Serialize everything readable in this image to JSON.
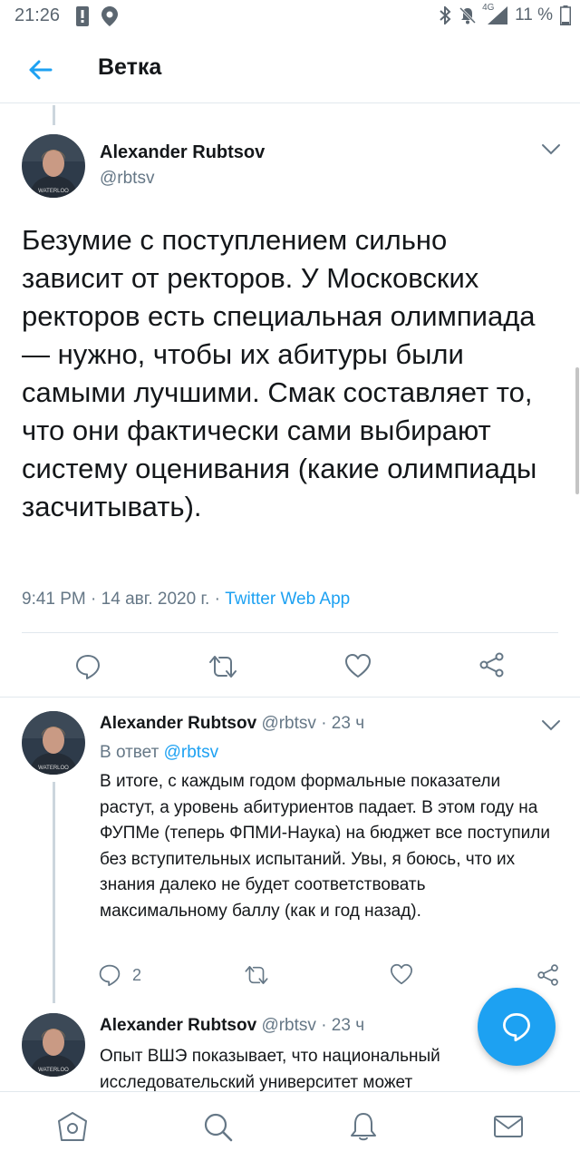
{
  "status_bar": {
    "time": "21:26",
    "battery": "11 %",
    "network": "4G",
    "icons": [
      "alert-icon",
      "location-icon",
      "bluetooth-icon",
      "mute-icon",
      "signal-icon",
      "battery-icon"
    ]
  },
  "header": {
    "title": "Ветка",
    "back_icon": "arrow-left-icon"
  },
  "main_tweet": {
    "name": "Alexander Rubtsov",
    "handle": "@rbtsv",
    "text": "Безумие с поступлением сильно зависит от ректоров. У Московских ректоров есть специальная олимпиада — нужно, чтобы их абитуры были самыми лучшими. Смак составляет то, что они фактически сами выбирают систему оценивания (какие олимпиады засчитывать).",
    "time": "9:41 PM",
    "date": "14 авг. 2020 г.",
    "sep": "·",
    "source": "Twitter Web App"
  },
  "replies": [
    {
      "name": "Alexander Rubtsov",
      "handle": "@rbtsv",
      "time_ago": "23 ч",
      "sep": "·",
      "reply_prefix": "В ответ",
      "reply_to": "@rbtsv",
      "text": "В итоге, с каждым годом формальные показатели растут, а уровень абитуриентов падает. В этом году на ФУПМе (теперь ФПМИ-Наука) на бюджет все поступили без вступительных испытаний. Увы, я боюсь, что их знания далеко не будет соответствовать максимальному баллу (как и год назад).",
      "reply_count": "2"
    },
    {
      "name": "Alexander Rubtsov",
      "handle": "@rbtsv",
      "time_ago": "23 ч",
      "sep": "·",
      "text": "Опыт ВШЭ показывает, что национальный исследовательский университет может"
    }
  ],
  "bottom_nav": [
    "home-icon",
    "search-icon",
    "notifications-icon",
    "messages-icon"
  ],
  "colors": {
    "accent": "#1da1f2",
    "text": "#14171a",
    "secondary": "#657786",
    "border": "#e1e8ed"
  }
}
